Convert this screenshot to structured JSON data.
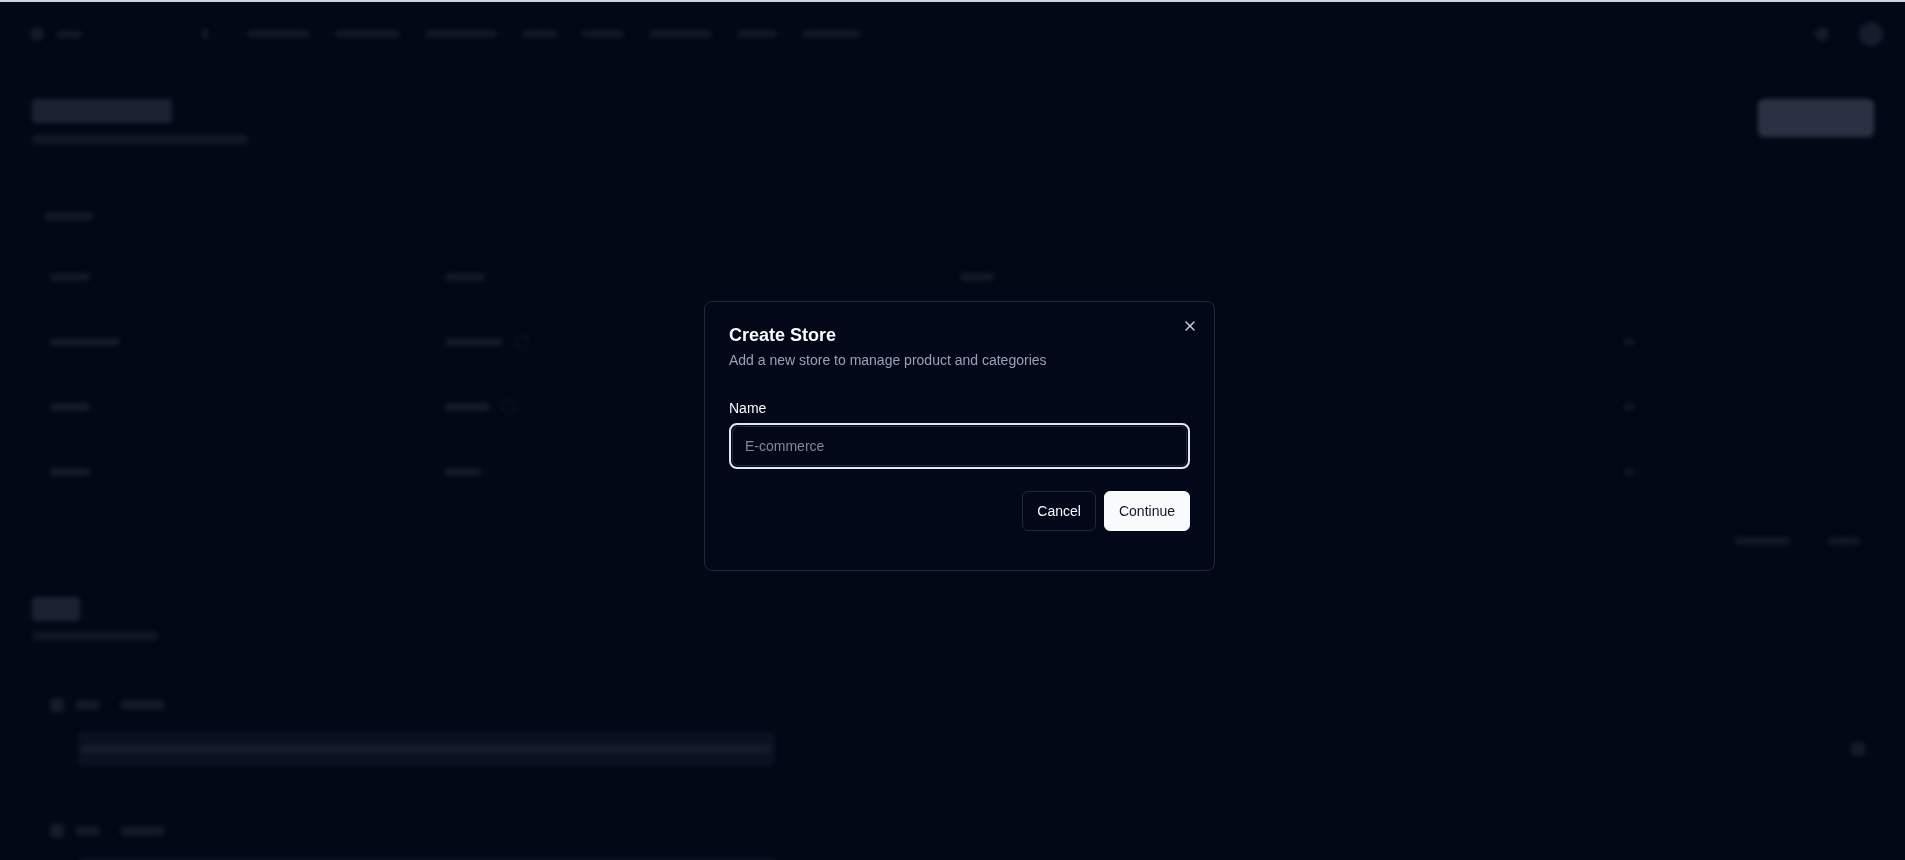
{
  "dialog": {
    "title": "Create Store",
    "description": "Add a new store to manage product and categories",
    "fields": [
      {
        "label": "Name",
        "placeholder": "E-commerce",
        "focused": true
      }
    ],
    "buttons": [
      {
        "label": "Cancel",
        "kind": "secondary"
      },
      {
        "label": "Continue",
        "kind": "primary"
      }
    ]
  }
}
